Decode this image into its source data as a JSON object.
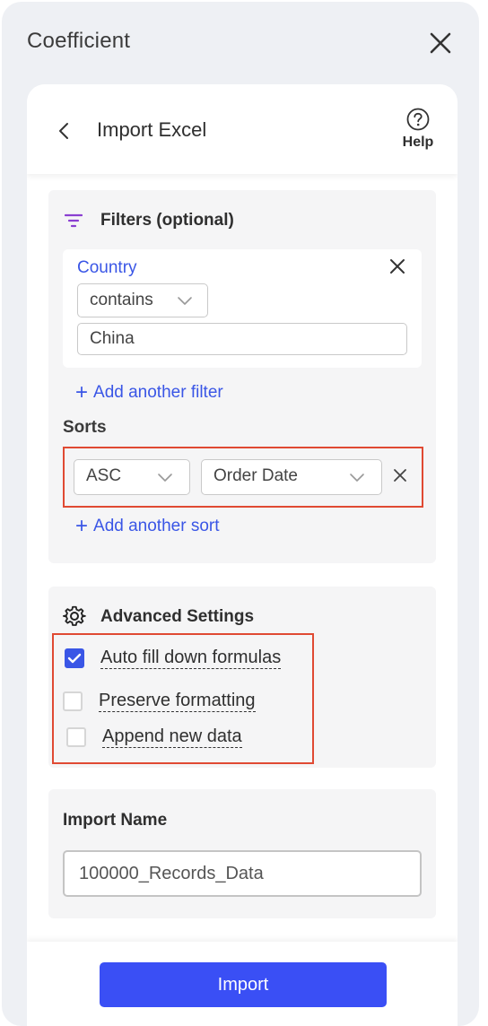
{
  "app": {
    "title": "Coefficient"
  },
  "header": {
    "title": "Import Excel",
    "help_label": "Help"
  },
  "filters": {
    "title": "Filters (optional)",
    "filter": {
      "field": "Country",
      "operator": "contains",
      "value": "China"
    },
    "add_label": "Add another filter"
  },
  "sorts": {
    "title": "Sorts",
    "direction": "ASC",
    "column": "Order Date",
    "add_label": "Add another sort"
  },
  "advanced": {
    "title": "Advanced Settings",
    "options": [
      {
        "label": "Auto fill down formulas",
        "checked": true
      },
      {
        "label": "Preserve formatting",
        "checked": false
      },
      {
        "label": "Append new data",
        "checked": false
      }
    ]
  },
  "import_name": {
    "title": "Import Name",
    "value": "100000_Records_Data"
  },
  "footer": {
    "import_label": "Import"
  },
  "colors": {
    "accent": "#3a56e6",
    "button": "#3a4ff5",
    "highlight": "#e04a33"
  }
}
